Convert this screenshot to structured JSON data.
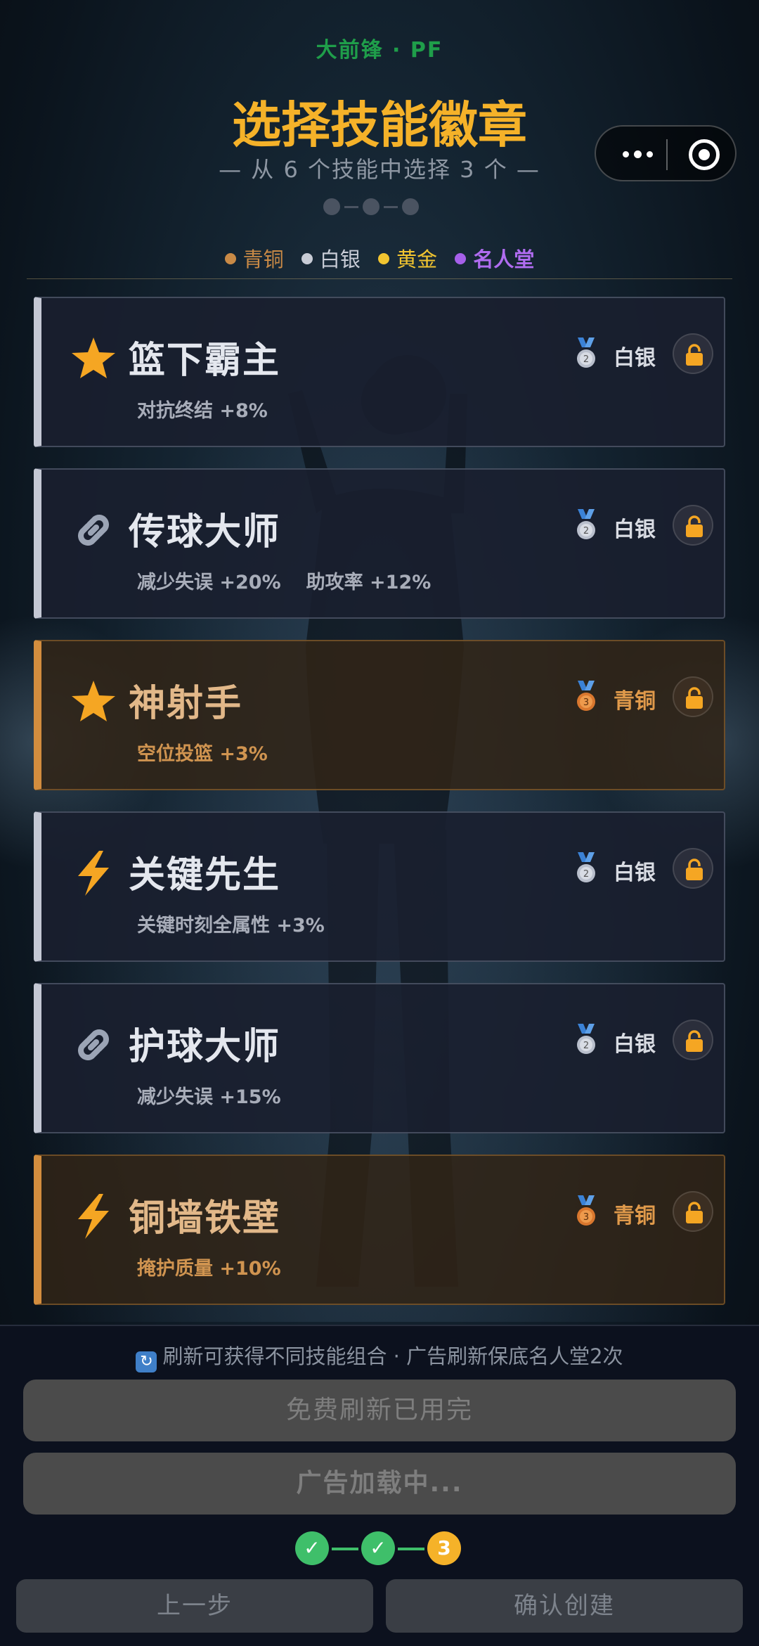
{
  "header": {
    "position_label": "大前锋 · PF",
    "title": "选择技能徽章",
    "subtitle": "— 从 6 个技能中选择 3 个 —"
  },
  "capsule": {
    "more_icon": "more-dots-icon",
    "close_icon": "target-circle-icon"
  },
  "legend": [
    {
      "label": "青铜",
      "color": "#c98a46"
    },
    {
      "label": "白银",
      "color": "#c8ccd6"
    },
    {
      "label": "黄金",
      "color": "#f2c530"
    },
    {
      "label": "名人堂",
      "color": "#a660ea"
    }
  ],
  "skills": [
    {
      "name": "篮下霸主",
      "icon": "star-icon",
      "tier": "白银",
      "medal_number": "2",
      "stats": [
        "对抗终结 +8%"
      ]
    },
    {
      "name": "传球大师",
      "icon": "link-icon",
      "tier": "白银",
      "medal_number": "2",
      "stats": [
        "减少失误 +20%",
        "助攻率 +12%"
      ]
    },
    {
      "name": "神射手",
      "icon": "star-icon",
      "tier": "青铜",
      "medal_number": "3",
      "stats": [
        "空位投篮 +3%"
      ]
    },
    {
      "name": "关键先生",
      "icon": "lightning-icon",
      "tier": "白银",
      "medal_number": "2",
      "stats": [
        "关键时刻全属性 +3%"
      ]
    },
    {
      "name": "护球大师",
      "icon": "link-icon",
      "tier": "白银",
      "medal_number": "2",
      "stats": [
        "减少失误 +15%"
      ]
    },
    {
      "name": "铜墙铁壁",
      "icon": "lightning-icon",
      "tier": "青铜",
      "medal_number": "3",
      "stats": [
        "掩护质量 +10%"
      ]
    }
  ],
  "colors": {
    "accent_gold": "#f5b229",
    "position_green": "#1f9e4a",
    "silver_bar": "#c4c8d4",
    "bronze_bar": "#d38d3e",
    "check_green": "#3fbf6a",
    "current_step": "#f5b229"
  },
  "footer": {
    "tip_icon": "refresh-icon",
    "tip": "刷新可获得不同技能组合 · 广告刷新保底名人堂2次",
    "free_refresh_label": "免费刷新已用完",
    "ad_label": "广告加载中...",
    "progress": [
      {
        "state": "done",
        "label": "✓"
      },
      {
        "state": "done",
        "label": "✓"
      },
      {
        "state": "current",
        "label": "3"
      }
    ],
    "prev_label": "上一步",
    "confirm_label": "确认创建"
  }
}
